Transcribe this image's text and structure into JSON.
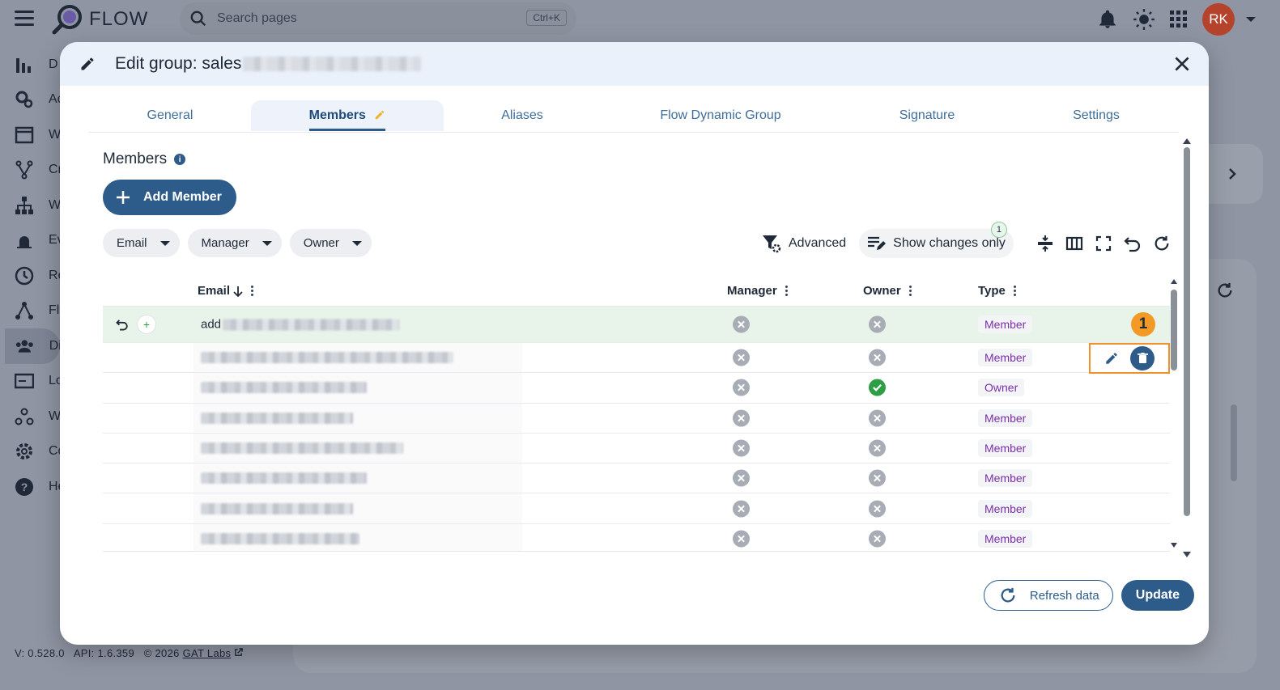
{
  "app": {
    "name": "FLOW",
    "search_placeholder": "Search pages",
    "search_shortcut": "Ctrl+K",
    "avatar_initials": "RK"
  },
  "sidebar": {
    "items": [
      {
        "label": "D",
        "icon": "bar-chart-icon"
      },
      {
        "label": "Ac",
        "icon": "cogs-icon"
      },
      {
        "label": "W",
        "icon": "window-icon"
      },
      {
        "label": "Cr",
        "icon": "fork-icon"
      },
      {
        "label": "W",
        "icon": "hierarchy-icon"
      },
      {
        "label": "Ev",
        "icon": "alarm-icon"
      },
      {
        "label": "Re",
        "icon": "clock-icon"
      },
      {
        "label": "Fl",
        "icon": "network-icon"
      },
      {
        "label": "Di",
        "icon": "people-icon"
      },
      {
        "label": "Lo",
        "icon": "card-icon"
      },
      {
        "label": "W",
        "icon": "webhook-icon"
      },
      {
        "label": "Co",
        "icon": "gear-icon"
      },
      {
        "label": "He",
        "icon": "help-icon"
      }
    ]
  },
  "footer": {
    "version": "V: 0.528.0",
    "api": "API: 1.6.359",
    "copyright": "© 2026",
    "link": "GAT Labs"
  },
  "modal": {
    "title": "Edit group: sales",
    "tabs": [
      "General",
      "Members",
      "Aliases",
      "Flow Dynamic Group",
      "Signature",
      "Settings"
    ],
    "active_tab": "Members",
    "section_title": "Members",
    "add_member_label": "Add Member",
    "filters": [
      "Email",
      "Manager",
      "Owner"
    ],
    "toolbar": {
      "advanced_label": "Advanced",
      "show_changes_label": "Show changes only",
      "changes_count": "1"
    },
    "columns": {
      "email": "Email",
      "manager": "Manager",
      "owner": "Owner",
      "type": "Type"
    },
    "new_row_email": "add",
    "rows": [
      {
        "manager": false,
        "owner": false,
        "type": "Member"
      },
      {
        "manager": false,
        "owner": false,
        "type": "Member"
      },
      {
        "manager": false,
        "owner": true,
        "type": "Owner"
      },
      {
        "manager": false,
        "owner": false,
        "type": "Member"
      },
      {
        "manager": false,
        "owner": false,
        "type": "Member"
      },
      {
        "manager": false,
        "owner": false,
        "type": "Member"
      },
      {
        "manager": false,
        "owner": false,
        "type": "Member"
      },
      {
        "manager": false,
        "owner": false,
        "type": "Member"
      }
    ],
    "annotation_number": "1",
    "refresh_label": "Refresh data",
    "update_label": "Update"
  },
  "colors": {
    "primary": "#2d5c8a",
    "accent_orange": "#f39a26",
    "type_text": "#7b2fa8",
    "new_row_bg": "#e8f4ea"
  }
}
